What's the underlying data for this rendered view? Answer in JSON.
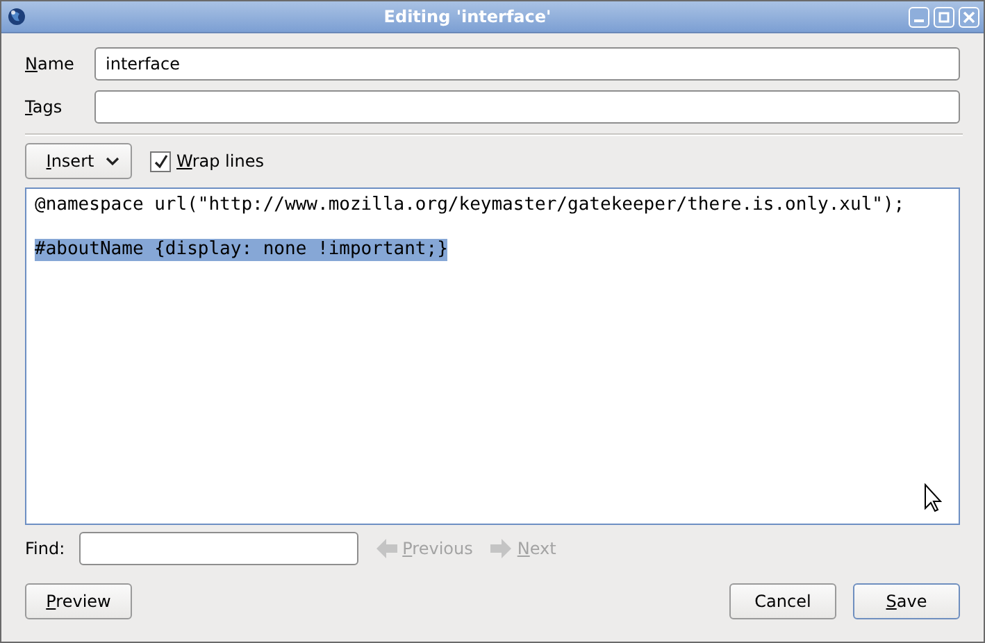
{
  "window": {
    "title": "Editing 'interface'"
  },
  "fields": [
    {
      "label": "Name",
      "mnemonic": true,
      "value": "interface"
    },
    {
      "label": "Tags",
      "mnemonic": true
    }
  ],
  "insert_button": {
    "label": "Insert",
    "mnemonic": true
  },
  "wrap_lines": {
    "label": "Wrap lines",
    "mnemonic": true,
    "checked": true
  },
  "code_lines": [
    {
      "text": "@namespace url(\"http://www.mozilla.org/keymaster/gatekeeper/there.is.only.xul\");",
      "selected": false
    },
    {
      "text": "#aboutName {display: none !important;}",
      "selected": true
    }
  ],
  "find": {
    "label": "Find:"
  },
  "find_buttons": [
    {
      "label": "Previous",
      "mnemonic": true,
      "disabled": true
    },
    {
      "label": "Next",
      "mnemonic": true,
      "disabled": true
    }
  ],
  "left_buttons": [
    {
      "label": "Preview",
      "mnemonic": true,
      "default": false
    }
  ],
  "right_buttons": [
    {
      "label": "Cancel",
      "mnemonic": false,
      "default": false
    },
    {
      "label": "Save",
      "mnemonic": true,
      "default": true
    }
  ]
}
